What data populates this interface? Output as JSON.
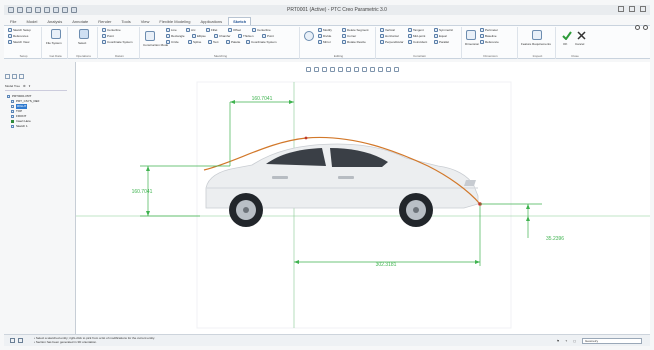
{
  "window": {
    "title": "PRT0001 (Active) - PTC Creo Parametric 3.0"
  },
  "tabs": [
    {
      "label": "File",
      "active": false
    },
    {
      "label": "Model",
      "active": false
    },
    {
      "label": "Analysis",
      "active": false
    },
    {
      "label": "Annotate",
      "active": false
    },
    {
      "label": "Render",
      "active": false
    },
    {
      "label": "Tools",
      "active": false
    },
    {
      "label": "View",
      "active": false
    },
    {
      "label": "Flexible Modeling",
      "active": false
    },
    {
      "label": "Applications",
      "active": false
    },
    {
      "label": "Sketch",
      "active": true
    }
  ],
  "ribbon": {
    "groups": [
      {
        "label": "Setup",
        "commands": [
          "Sketch Setup",
          "References",
          "Sketch View"
        ]
      },
      {
        "label": "Get Data",
        "commands": [
          "File System"
        ]
      },
      {
        "label": "Operations",
        "commands": [
          "Select"
        ]
      },
      {
        "label": "Datum",
        "commands": [
          "Centerline",
          "Point",
          "Coordinate System"
        ]
      },
      {
        "label": "Sketching",
        "commands": [
          "Construction Mode",
          "Line",
          "Arc",
          "Fillet",
          "Offset",
          "Centerline",
          "Rectangle",
          "Ellipse",
          "Chamfer",
          "Thicken",
          "Point",
          "Circle",
          "Spline",
          "Text",
          "Palette",
          "Coordinate System"
        ]
      },
      {
        "label": "Editing",
        "commands": [
          "Modify",
          "Divide",
          "Delete Segment",
          "Mirror",
          "Corner",
          "Rotate Resize"
        ]
      },
      {
        "label": "Constrain",
        "commands": [
          "Vertical",
          "Tangent",
          "Symmetric",
          "Horizontal",
          "Mid-point",
          "Equal",
          "Perpendicular",
          "Coincident",
          "Parallel"
        ]
      },
      {
        "label": "Dimension",
        "commands": [
          "Dimension",
          "Perimeter",
          "Baseline",
          "Reference"
        ]
      },
      {
        "label": "Inspect",
        "commands": [
          "Feature Requirements"
        ]
      },
      {
        "label": "Close",
        "commands": [
          "OK",
          "Cancel"
        ]
      }
    ]
  },
  "model_tree": {
    "header": "Model Tree",
    "items": [
      {
        "label": "PRT0001.PRT",
        "selected": false
      },
      {
        "label": "PRT_CSYS_DEF",
        "selected": false
      },
      {
        "label": "RIGHT",
        "selected": true
      },
      {
        "label": "TOP",
        "selected": false
      },
      {
        "label": "FRONT",
        "selected": false
      },
      {
        "label": "Insert Here",
        "selected": false
      },
      {
        "label": "Sketch 1",
        "selected": false
      }
    ]
  },
  "sketch": {
    "dimensions": {
      "top": "160.7041",
      "left": "160.7041",
      "right": "35.2396",
      "bottom": "302.3181"
    },
    "colors": {
      "dimension": "#3fb34f",
      "spline": "#d2782a",
      "endpoint": "#c0392b"
    }
  },
  "status": {
    "messages": [
      "• Select a sketched entity; right-click to pick from a list of modifications for the current entity.",
      "• Section has been generated in 3D orientation."
    ],
    "smart_filter": "Geometry",
    "icons": [
      "graphics-icon",
      "regen-icon"
    ]
  }
}
